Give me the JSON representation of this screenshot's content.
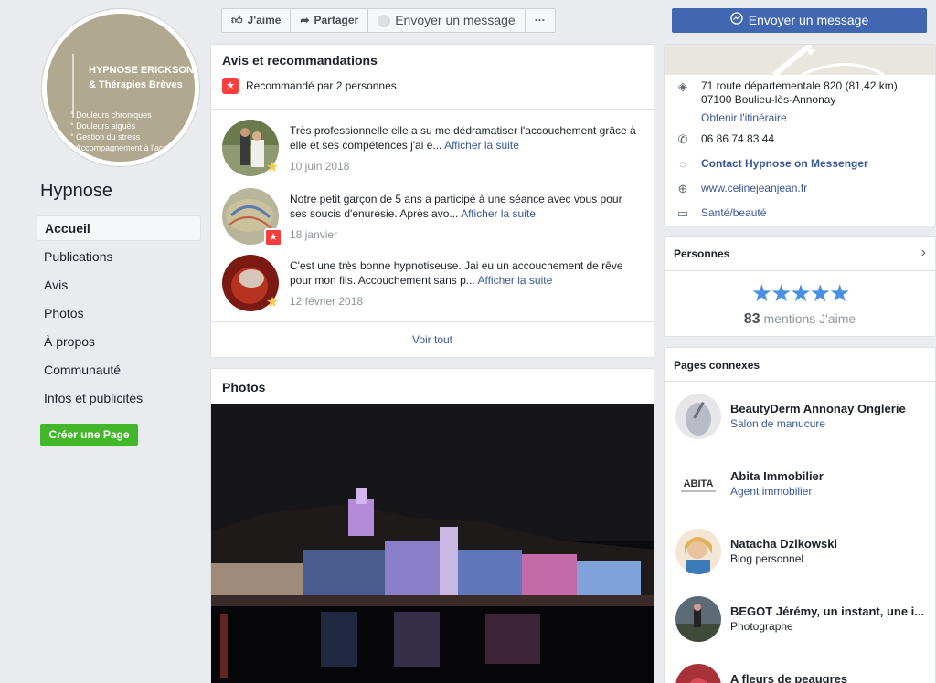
{
  "left": {
    "profile": {
      "line1": "HYPNOSE ERICKSONIE",
      "line2": "& Thérapies Brèves",
      "bullets": [
        "° Douleurs chroniques",
        "° Douleurs aiguës",
        "° Gestion du stress",
        "° Accompagnement à l'acc"
      ]
    },
    "page_name": "Hypnose",
    "nav": [
      "Accueil",
      "Publications",
      "Avis",
      "Photos",
      "À propos",
      "Communauté",
      "Infos et publicités"
    ],
    "create_page": "Créer une Page"
  },
  "action_bar": {
    "like": "J'aime",
    "share": "Partager",
    "message": "Envoyer un message",
    "more": "···"
  },
  "send_message_button": "Envoyer un message",
  "reviews": {
    "title": "Avis et recommandations",
    "recommended": "Recommandé par 2 personnes",
    "items": [
      {
        "text": "Très professionnelle elle a su me dédramatiser l'accouchement grâce à elle et ses compétences j'ai e...",
        "more": "Afficher la suite",
        "date": "10 juin 2018"
      },
      {
        "text": "Notre petit garçon de 5 ans a participé à une séance avec vous pour ses soucis d'enuresie. Après avo...",
        "more": "Afficher la suite",
        "date": "18 janvier"
      },
      {
        "text": "C'est une très bonne hypnotiseuse. Jai eu un accouchement de rêve pour mon fils. Accouchement sans p...",
        "more": "Afficher la suite",
        "date": "12 février 2018"
      }
    ],
    "see_all": "Voir tout"
  },
  "photos": {
    "title": "Photos"
  },
  "info": {
    "address1": "71 route départementale 820 (81,42 km)",
    "address2": "07100 Boulieu-lès-Annonay",
    "directions": "Obtenir l'itinéraire",
    "phone": "06 86 74 83 44",
    "messenger": "Contact Hypnose on Messenger",
    "website": "www.celinejeanjean.fr",
    "category": "Santé/beauté"
  },
  "people": {
    "title": "Personnes",
    "stars": "★★★★★",
    "likes_count": "83",
    "likes_label": "mentions J'aime"
  },
  "related": {
    "title": "Pages connexes",
    "items": [
      {
        "name": "BeautyDerm Annonay Onglerie",
        "category": "Salon de manucure"
      },
      {
        "name": "Abita Immobilier",
        "category": "Agent immobilier"
      },
      {
        "name": "Natacha Dzikowski",
        "category": "Blog personnel"
      },
      {
        "name": "BEGOT Jérémy, un instant, une i...",
        "category": "Photographe"
      },
      {
        "name": "A fleurs de peaugres",
        "category": ""
      }
    ]
  },
  "colors": {
    "facebook_blue": "#4267b2",
    "link": "#385898",
    "green": "#42b72a",
    "star_blue": "#4a90e2",
    "rec_red": "#fa3e3e"
  }
}
